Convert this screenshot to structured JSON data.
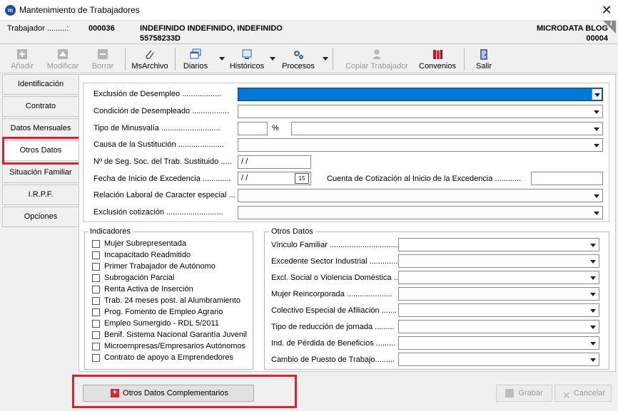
{
  "window": {
    "title": "Mantenimiento de Trabajadores",
    "close": "✕"
  },
  "employee": {
    "label": "Trabajador .........:",
    "code": "000036",
    "name": "INDEFINIDO INDEFINIDO, INDEFINIDO",
    "id": "55758233D",
    "company": "MICRODATA BLOG",
    "company_code": "00004",
    "info_glyph": "i"
  },
  "toolbar": {
    "add": "Añadir",
    "modify": "Modificar",
    "delete": "Borrar",
    "msarchivo": "MsArchivo",
    "diaries": "Diarios",
    "historicals": "Históricos",
    "processes": "Procesos",
    "copy": "Copiar Trabajador",
    "agreements": "Convenios",
    "exit": "Salir"
  },
  "tabs": [
    "Identificación",
    "Contrato",
    "Datos Mensuales",
    "Otros Datos",
    "Situación Familiar",
    "I.R.P.F.",
    "Opciones"
  ],
  "form": {
    "exclusion_desempleo": "Exclusión de Desempleo ..................",
    "condicion_desempleado": "Condición de Desempleado .................",
    "tipo_minusvalia": "Tipo de Minusvalía ...........................",
    "percent": "%",
    "causa_sustitucion": "Causa de la Sustitución .....................",
    "nss_sustituido": "Nº de Seg. Soc. del Trab. Sustituido .....",
    "nss_value": "/      /",
    "fecha_excedencia": "Fecha de Inicio de Excedencia .............",
    "fecha_value": "/ /",
    "calendar_icon": "15",
    "cuenta_cotizacion": "Cuenta de Cotización al Inicio de la Excedencia ............",
    "relacion_laboral": "Relación Laboral de Caracter especial ...",
    "exclusion_cotizacion": "Exclusión cotización .........................."
  },
  "indicadores": {
    "title": "Indicadores",
    "items": [
      "Mujer Subrepresentada",
      "Incapacitado Readmitido",
      "Primer Trabajador de Autónomo",
      "Subrogación Parcial",
      "Renta Activa de Inserción",
      "Trab. 24 meses post. al Alumbramiento",
      "Prog. Fomento de Empleo Agrario",
      "Empleo Sumergido - RDL 5/2011",
      "Benif. Sistema Nacional Garantía Juvenil",
      "Microempresas/Empresarios Autónomos",
      "Contrato de apoyo a Emprendedores"
    ]
  },
  "otros_datos": {
    "title": "Otros Datos",
    "items": [
      "Vínculo Familiar ................................",
      "Excedente Sector Industrial ..............",
      "Excl. Social o Violencia Doméstica ..",
      "Mujer Reincorporada .....................",
      "Colectivo Especial de Afiliación .......",
      "Tipo de reducción de jornada .........",
      "Ind. de Pérdida de Beneficios .........",
      "Cambio de Puesto de Trabajo........."
    ]
  },
  "buttons": {
    "otros_complementarios": "Otros Datos Complementarios",
    "grabar": "Grabar",
    "cancelar": "Cancelar"
  },
  "colors": {
    "highlight": "#e0202a",
    "selection": "#0078d7",
    "app_icon": "#1f4e9a"
  }
}
